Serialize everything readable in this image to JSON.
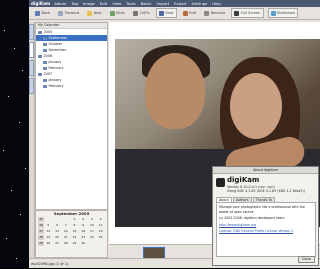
{
  "menubar": {
    "app": "digiKam",
    "items": [
      "Album",
      "Tag",
      "Image",
      "Edit",
      "View",
      "Tools",
      "Batch",
      "Import",
      "Export",
      "Settings",
      "Help"
    ]
  },
  "window_title": "digiKam",
  "toolbar": {
    "back": "Back",
    "forward": "Forward",
    "new": "New",
    "slide": "Slide",
    "zoom": "100%",
    "view": "View",
    "edit": "Edit",
    "rename": "Rename",
    "fullscreen": "Full Screen",
    "slideshow": "Slideshow"
  },
  "left_panel": {
    "header": "My Calendar",
    "tree": [
      {
        "label": "2005",
        "indent": 0
      },
      {
        "label": "September",
        "indent": 1,
        "selected": true
      },
      {
        "label": "October",
        "indent": 1
      },
      {
        "label": "December",
        "indent": 1
      },
      {
        "label": "2006",
        "indent": 0
      },
      {
        "label": "January",
        "indent": 1
      },
      {
        "label": "February",
        "indent": 1
      },
      {
        "label": "2007",
        "indent": 0
      },
      {
        "label": "January",
        "indent": 1
      },
      {
        "label": "February",
        "indent": 1
      }
    ]
  },
  "calendar": {
    "title": "September 2005",
    "weeks": [
      "35",
      "36",
      "37",
      "38",
      "39"
    ],
    "rows": [
      [
        "",
        "",
        "",
        "1",
        "2",
        "3",
        "4"
      ],
      [
        "5",
        "6",
        "7",
        "8",
        "9",
        "10",
        "11"
      ],
      [
        "12",
        "13",
        "14",
        "15",
        "16",
        "17",
        "18"
      ],
      [
        "19",
        "20",
        "21",
        "22",
        "23",
        "24",
        "25"
      ],
      [
        "26",
        "27",
        "28",
        "29",
        "30",
        "",
        ""
      ]
    ]
  },
  "status": "dscf2098.jpg (1 of 1)",
  "about": {
    "title": "About digiKam",
    "app_name": "digiKam",
    "version": "Version 0.10.0-rc1 (rev.: svn)",
    "kde_line": "Using KDE 4.1.65 (KDE 4.1.65 (KDE 4.2 Beta2))",
    "tabs": [
      "About",
      "Authors",
      "Thanks To"
    ],
    "active_tab": "About",
    "description": "Manage your photographs like a professional with the power of open source",
    "copyright": "(c) 2002-2008, digiKam developers team",
    "url": "http://www.digikam.org",
    "license": "License: GNU General Public License Version 2",
    "close": "Close"
  }
}
